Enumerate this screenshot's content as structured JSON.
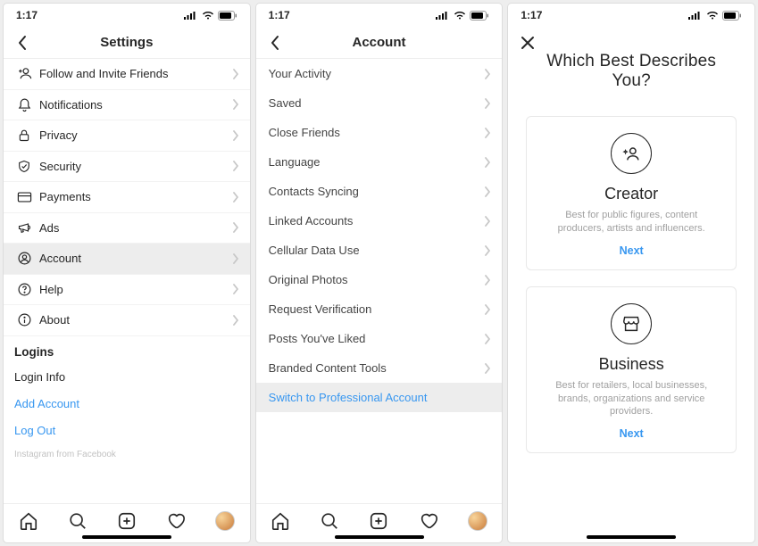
{
  "status": {
    "time": "1:17"
  },
  "screen1": {
    "title": "Settings",
    "rows": [
      {
        "label": "Follow and Invite Friends"
      },
      {
        "label": "Notifications"
      },
      {
        "label": "Privacy"
      },
      {
        "label": "Security"
      },
      {
        "label": "Payments"
      },
      {
        "label": "Ads"
      },
      {
        "label": "Account"
      },
      {
        "label": "Help"
      },
      {
        "label": "About"
      }
    ],
    "logins_header": "Logins",
    "login_info": "Login Info",
    "add_account": "Add Account",
    "log_out": "Log Out",
    "footnote": "Instagram from Facebook"
  },
  "screen2": {
    "title": "Account",
    "rows": [
      {
        "label": "Your Activity"
      },
      {
        "label": "Saved"
      },
      {
        "label": "Close Friends"
      },
      {
        "label": "Language"
      },
      {
        "label": "Contacts Syncing"
      },
      {
        "label": "Linked Accounts"
      },
      {
        "label": "Cellular Data Use"
      },
      {
        "label": "Original Photos"
      },
      {
        "label": "Request Verification"
      },
      {
        "label": "Posts You've Liked"
      },
      {
        "label": "Branded Content Tools"
      },
      {
        "label": "Switch to Professional Account"
      }
    ]
  },
  "screen3": {
    "title": "Which Best Describes You?",
    "creator": {
      "heading": "Creator",
      "desc": "Best for public figures, content producers, artists and influencers.",
      "next": "Next"
    },
    "business": {
      "heading": "Business",
      "desc": "Best for retailers, local businesses, brands, organizations and service providers.",
      "next": "Next"
    }
  }
}
